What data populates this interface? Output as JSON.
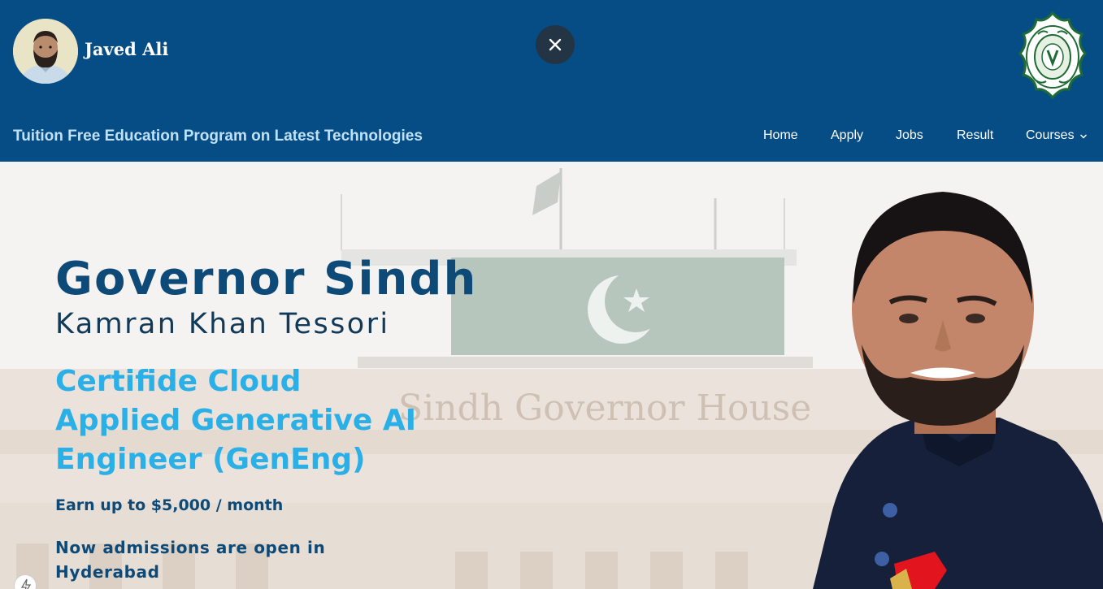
{
  "header": {
    "user_name": "Javed Ali",
    "program_title": "Tuition Free Education Program on Latest Technologies",
    "close_icon": "close-icon",
    "seal_icon": "governor-house-seal"
  },
  "nav": {
    "items": [
      {
        "label": "Home"
      },
      {
        "label": "Apply"
      },
      {
        "label": "Jobs"
      },
      {
        "label": "Result"
      },
      {
        "label": "Courses"
      }
    ]
  },
  "hero": {
    "title": "Governor Sindh",
    "subtitle": "Kamran Khan Tessori",
    "course_lines": [
      "Certifide Cloud",
      "Applied Generative AI",
      "Engineer (GenEng)"
    ],
    "earn": "Earn up to $5,000 / month",
    "admission_lines": [
      "Now admissions are open in",
      "Hyderabad"
    ],
    "background_sign": "Sindh Governor House"
  },
  "colors": {
    "header_bg": "#074d85",
    "title_blue": "#0d4a78",
    "accent_cyan": "#2ab0e6",
    "program_title": "#bfe1f7"
  }
}
